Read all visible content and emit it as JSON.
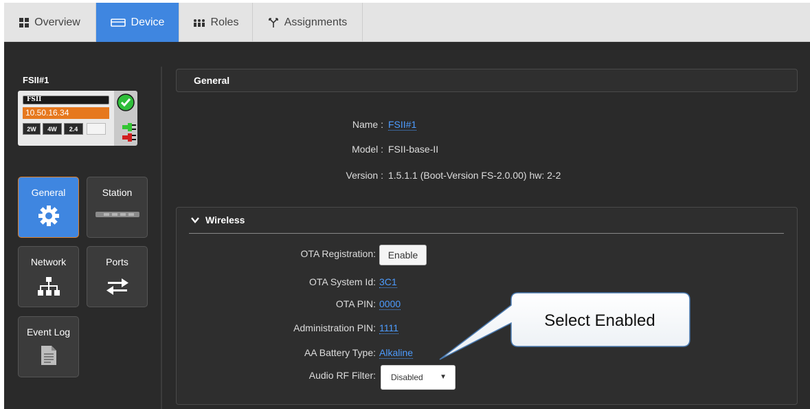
{
  "tabs": [
    {
      "label": "Overview",
      "icon": "grid-icon",
      "active": false
    },
    {
      "label": "Device",
      "icon": "device-icon",
      "active": true
    },
    {
      "label": "Roles",
      "icon": "people-icon",
      "active": false
    },
    {
      "label": "Assignments",
      "icon": "branch-icon",
      "active": false
    }
  ],
  "device": {
    "title": "FSII#1",
    "card_name": "FSII",
    "ip": "10.50.16.34",
    "badges": [
      "2W",
      "4W",
      "2.4"
    ],
    "status_icon": "check-circle-icon",
    "colors": {
      "ip_bar": "#e6781e",
      "status_green": "#2fbe3a",
      "plug_green": "#33c533",
      "plug_red": "#d11f1f"
    }
  },
  "nav": {
    "general": {
      "label": "General",
      "icon": "gear-icon",
      "active": true
    },
    "station": {
      "label": "Station",
      "icon": "station-bar-icon",
      "active": false
    },
    "network": {
      "label": "Network",
      "icon": "network-icon",
      "active": false
    },
    "ports": {
      "label": "Ports",
      "icon": "arrows-exchange-icon",
      "active": false
    },
    "event_log": {
      "label": "Event Log",
      "icon": "document-icon",
      "active": false
    }
  },
  "general": {
    "header": "General",
    "name_label": "Name :",
    "name_value": "FSII#1",
    "model_label": "Model :",
    "model_value": "FSII-base-II",
    "version_label": "Version :",
    "version_value": "1.5.1.1 (Boot-Version FS-2.0.00) hw: 2-2"
  },
  "wireless": {
    "header": "Wireless",
    "ota_registration_label": "OTA Registration:",
    "ota_registration_button": "Enable",
    "ota_system_id_label": "OTA System Id:",
    "ota_system_id_value": "3C1",
    "ota_pin_label": "OTA PIN:",
    "ota_pin_value": "0000",
    "admin_pin_label": "Administration PIN:",
    "admin_pin_value": "1111",
    "battery_label": "AA Battery Type:",
    "battery_value": "Alkaline",
    "audio_rf_label": "Audio RF Filter:",
    "audio_rf_value": "Disabled"
  },
  "callout": {
    "text": "Select Enabled"
  },
  "theme": {
    "accent": "#3f86e0",
    "link": "#4d9cff",
    "panel_bg": "#2a2a2a",
    "active_border": "#e0812a"
  }
}
